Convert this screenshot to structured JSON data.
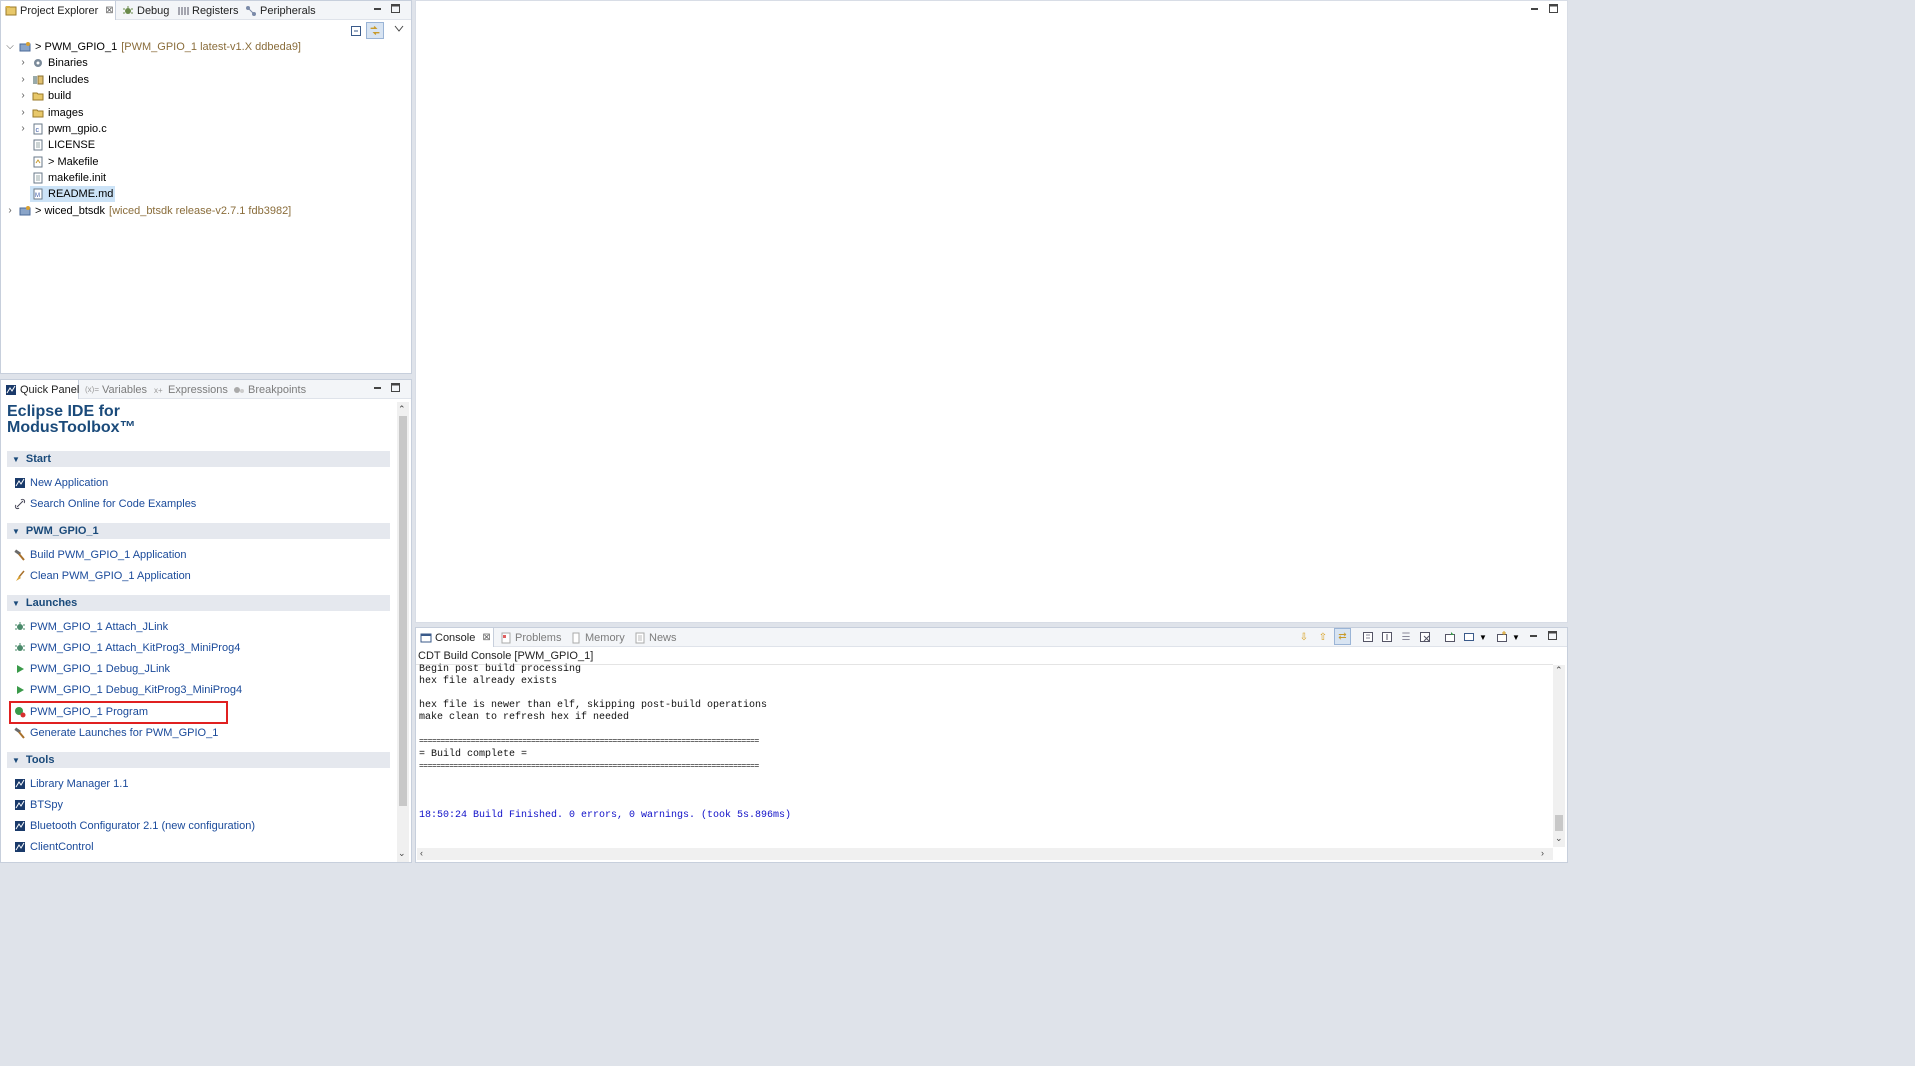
{
  "explorer": {
    "tabs": [
      {
        "label": "Project Explorer",
        "close": "⊠"
      },
      {
        "label": "Debug"
      },
      {
        "label": "Registers"
      },
      {
        "label": "Peripherals"
      }
    ],
    "tree": [
      {
        "label": "> PWM_GPIO_1",
        "deco": "[PWM_GPIO_1 latest-v1.X ddbeda9]",
        "icon": "project-icon"
      },
      {
        "label": "Binaries",
        "icon": "binaries-icon"
      },
      {
        "label": "Includes",
        "icon": "includes-icon"
      },
      {
        "label": "build",
        "icon": "folder-icon"
      },
      {
        "label": "images",
        "icon": "folder-icon"
      },
      {
        "label": "pwm_gpio.c",
        "icon": "c-file-icon"
      },
      {
        "label": "LICENSE",
        "icon": "text-file-icon"
      },
      {
        "label": "> Makefile",
        "icon": "makefile-icon"
      },
      {
        "label": "makefile.init",
        "icon": "text-file-icon"
      },
      {
        "label": "README.md",
        "icon": "markdown-file-icon"
      },
      {
        "label": "> wiced_btsdk",
        "deco": "[wiced_btsdk release-v2.7.1 fdb3982]",
        "icon": "project-icon"
      }
    ]
  },
  "quickpanel": {
    "tabs": [
      {
        "label": "Quick Panel"
      },
      {
        "label": "Variables",
        "prefix": "(x)="
      },
      {
        "label": "Expressions"
      },
      {
        "label": "Breakpoints"
      }
    ],
    "title_line1": "Eclipse IDE for",
    "title_line2": "ModusToolbox™",
    "sections": {
      "start": {
        "label": "Start",
        "items": [
          "New Application",
          "Search Online for Code Examples"
        ]
      },
      "project": {
        "label": "PWM_GPIO_1",
        "items": [
          "Build PWM_GPIO_1 Application",
          "Clean PWM_GPIO_1 Application"
        ]
      },
      "launches": {
        "label": "Launches",
        "items": [
          "PWM_GPIO_1 Attach_JLink",
          "PWM_GPIO_1 Attach_KitProg3_MiniProg4",
          "PWM_GPIO_1 Debug_JLink",
          "PWM_GPIO_1 Debug_KitProg3_MiniProg4",
          "PWM_GPIO_1 Program",
          "Generate Launches for PWM_GPIO_1"
        ]
      },
      "tools": {
        "label": "Tools",
        "items": [
          "Library Manager 1.1",
          "BTSpy",
          "Bluetooth Configurator 2.1 (new configuration)",
          "ClientControl"
        ]
      }
    }
  },
  "console": {
    "tabs": [
      {
        "label": "Console",
        "close": "⊠"
      },
      {
        "label": "Problems"
      },
      {
        "label": "Memory"
      },
      {
        "label": "News"
      }
    ],
    "header": "CDT Build Console [PWM_GPIO_1]",
    "lines": [
      "Begin post build processing",
      "hex file already exists",
      "",
      "hex file is newer than elf, skipping post-build operations",
      "make clean to refresh hex if needed",
      "",
      "===============================================================================",
      "= Build complete =",
      "===============================================================================",
      "",
      "",
      "",
      "",
      "18:50:24 Build Finished. 0 errors, 0 warnings. (took 5s.896ms)"
    ]
  },
  "colors": {
    "link": "#1a4a9a",
    "section_bg": "#e5e8ee",
    "highlight_box": "#e02020",
    "finished_text": "#1010c8"
  }
}
